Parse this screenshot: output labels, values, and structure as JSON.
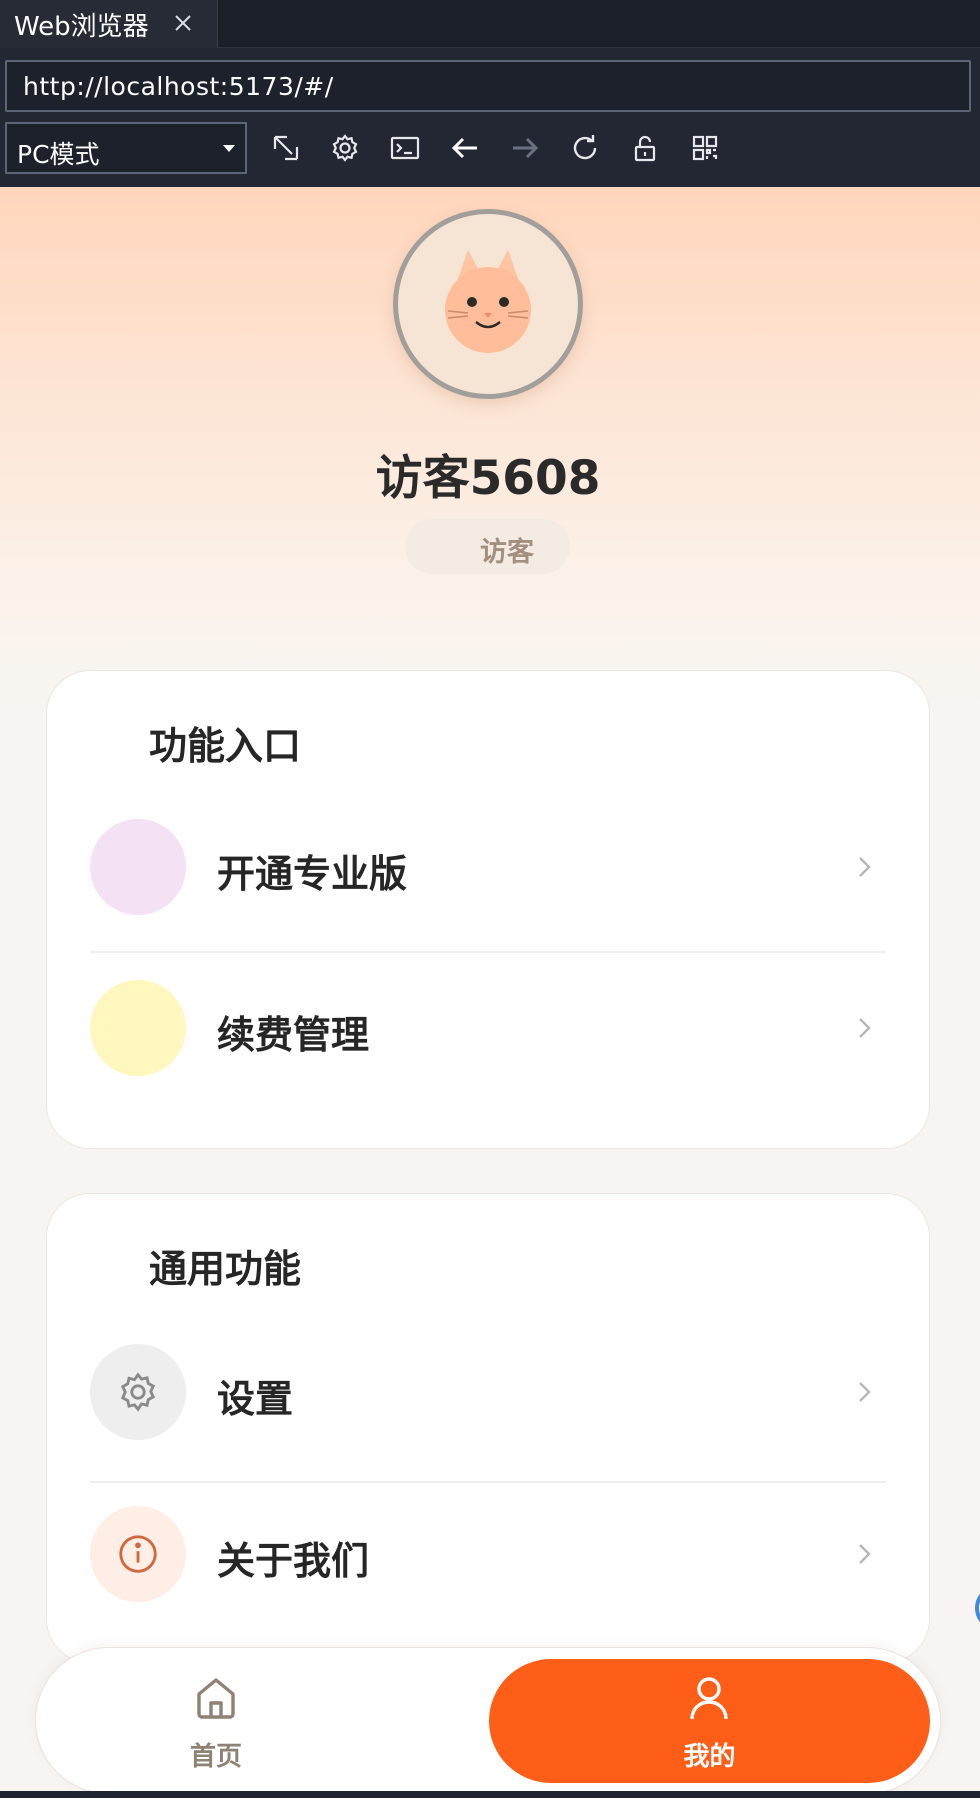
{
  "browser": {
    "tab_title": "Web浏览器",
    "url": "http://localhost:5173/#/",
    "mode_select": "PC模式",
    "tools": [
      "resize-icon",
      "gear-icon",
      "terminal-icon",
      "back-arrow-icon",
      "forward-arrow-icon",
      "reload-icon",
      "unlock-icon",
      "qrcode-icon"
    ]
  },
  "profile": {
    "username": "访客5608",
    "role": "访客"
  },
  "sections": [
    {
      "title": "功能入口",
      "items": [
        {
          "label": "开通专业版",
          "icon": "pro-icon",
          "icon_bg": "#f5e1f4"
        },
        {
          "label": "续费管理",
          "icon": "renew-icon",
          "icon_bg": "#fff7bd"
        }
      ]
    },
    {
      "title": "通用功能",
      "items": [
        {
          "label": "设置",
          "icon": "gear-icon",
          "icon_bg": "#eeeeee"
        },
        {
          "label": "关于我们",
          "icon": "info-icon",
          "icon_bg": "#ffeee6"
        }
      ]
    }
  ],
  "nav": {
    "home_label": "首页",
    "mine_label": "我的",
    "accent": "#ff5e19"
  }
}
